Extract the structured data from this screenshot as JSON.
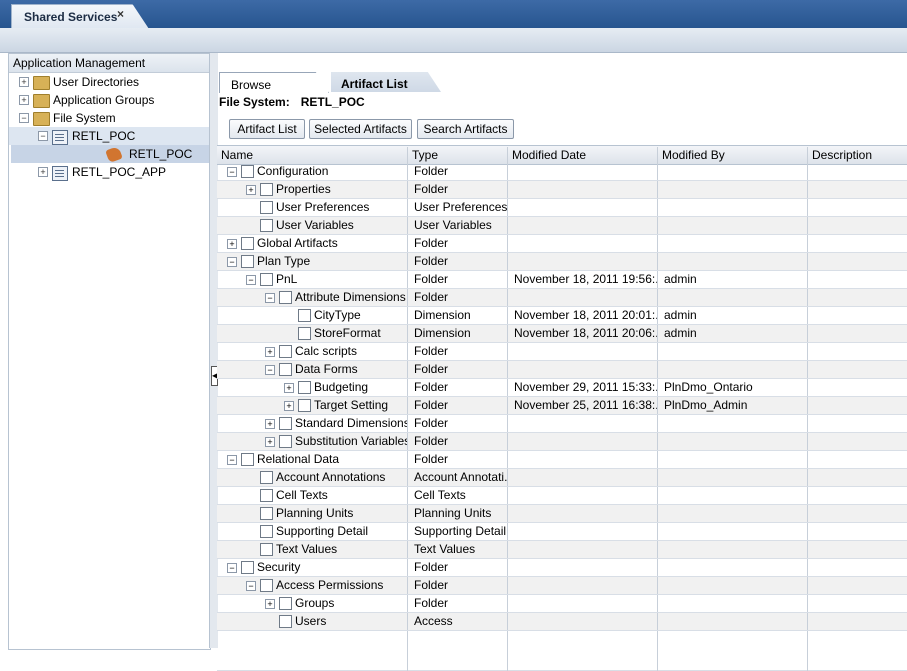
{
  "tab": {
    "title": "Shared Services",
    "close": "×"
  },
  "left_panel": {
    "title": "Application Management",
    "tree": [
      {
        "label": "User Directories",
        "expander": "+",
        "icon": "folder-icon"
      },
      {
        "label": "Application Groups",
        "expander": "+",
        "icon": "folder-icon"
      },
      {
        "label": "File System",
        "expander": "−",
        "icon": "folder-icon"
      },
      {
        "label": "RETL_POC",
        "expander": "−",
        "icon": "application-icon"
      },
      {
        "label": "RETL_POC",
        "expander": "",
        "icon": "migration-package-icon"
      },
      {
        "label": "RETL_POC_APP",
        "expander": "+",
        "icon": "application-icon"
      }
    ]
  },
  "subtabs": {
    "browse": "Browse",
    "artifact_list": "Artifact List"
  },
  "file_system": {
    "label": "File System:",
    "value": "RETL_POC"
  },
  "buttons": {
    "artifact_list": "Artifact List",
    "selected": "Selected Artifacts",
    "search": "Search Artifacts"
  },
  "columns": {
    "name": "Name",
    "type": "Type",
    "modified_date": "Modified Date",
    "modified_by": "Modified By",
    "description": "Description"
  },
  "rows": [
    {
      "name": "Configuration",
      "type": "Folder",
      "date": "",
      "by": "",
      "level": 0,
      "expander": "−"
    },
    {
      "name": "Properties",
      "type": "Folder",
      "date": "",
      "by": "",
      "level": 1,
      "expander": "+"
    },
    {
      "name": "User Preferences",
      "type": "User Preferences",
      "date": "",
      "by": "",
      "level": 1,
      "expander": ""
    },
    {
      "name": "User Variables",
      "type": "User Variables",
      "date": "",
      "by": "",
      "level": 1,
      "expander": ""
    },
    {
      "name": "Global Artifacts",
      "type": "Folder",
      "date": "",
      "by": "",
      "level": 0,
      "expander": "+"
    },
    {
      "name": "Plan Type",
      "type": "Folder",
      "date": "",
      "by": "",
      "level": 0,
      "expander": "−"
    },
    {
      "name": "PnL",
      "type": "Folder",
      "date": "November 18, 2011 19:56:...",
      "by": "admin",
      "level": 1,
      "expander": "−"
    },
    {
      "name": "Attribute Dimensions",
      "type": "Folder",
      "date": "",
      "by": "",
      "level": 2,
      "expander": "−"
    },
    {
      "name": "CityType",
      "type": "Dimension",
      "date": "November 18, 2011 20:01:...",
      "by": "admin",
      "level": 3,
      "expander": ""
    },
    {
      "name": "StoreFormat",
      "type": "Dimension",
      "date": "November 18, 2011 20:06:...",
      "by": "admin",
      "level": 3,
      "expander": ""
    },
    {
      "name": "Calc scripts",
      "type": "Folder",
      "date": "",
      "by": "",
      "level": 2,
      "expander": "+"
    },
    {
      "name": "Data Forms",
      "type": "Folder",
      "date": "",
      "by": "",
      "level": 2,
      "expander": "−"
    },
    {
      "name": "Budgeting",
      "type": "Folder",
      "date": "November 29, 2011 15:33:...",
      "by": "PlnDmo_Ontario",
      "level": 3,
      "expander": "+"
    },
    {
      "name": "Target Setting",
      "type": "Folder",
      "date": "November 25, 2011 16:38:...",
      "by": "PlnDmo_Admin",
      "level": 3,
      "expander": "+"
    },
    {
      "name": "Standard Dimensions",
      "type": "Folder",
      "date": "",
      "by": "",
      "level": 2,
      "expander": "+"
    },
    {
      "name": "Substitution Variables",
      "type": "Folder",
      "date": "",
      "by": "",
      "level": 2,
      "expander": "+"
    },
    {
      "name": "Relational Data",
      "type": "Folder",
      "date": "",
      "by": "",
      "level": 0,
      "expander": "−"
    },
    {
      "name": "Account Annotations",
      "type": "Account Annotati...",
      "date": "",
      "by": "",
      "level": 1,
      "expander": ""
    },
    {
      "name": "Cell Texts",
      "type": "Cell Texts",
      "date": "",
      "by": "",
      "level": 1,
      "expander": ""
    },
    {
      "name": "Planning Units",
      "type": "Planning Units",
      "date": "",
      "by": "",
      "level": 1,
      "expander": ""
    },
    {
      "name": "Supporting Detail",
      "type": "Supporting Detail",
      "date": "",
      "by": "",
      "level": 1,
      "expander": ""
    },
    {
      "name": "Text Values",
      "type": "Text Values",
      "date": "",
      "by": "",
      "level": 1,
      "expander": ""
    },
    {
      "name": "Security",
      "type": "Folder",
      "date": "",
      "by": "",
      "level": 0,
      "expander": "−"
    },
    {
      "name": "Access Permissions",
      "type": "Folder",
      "date": "",
      "by": "",
      "level": 1,
      "expander": "−"
    },
    {
      "name": "Groups",
      "type": "Folder",
      "date": "",
      "by": "",
      "level": 2,
      "expander": "+"
    },
    {
      "name": "Users",
      "type": "Access",
      "date": "",
      "by": "",
      "level": 2,
      "expander": ""
    }
  ]
}
